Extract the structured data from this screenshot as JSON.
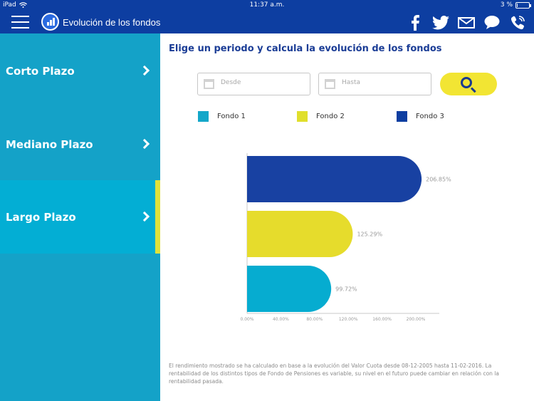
{
  "status_bar": {
    "device": "iPad",
    "time": "11:37 a.m.",
    "battery": "3 %"
  },
  "nav": {
    "title": "Evolución de los fondos",
    "actions": [
      {
        "icon": "facebook-icon"
      },
      {
        "icon": "twitter-icon"
      },
      {
        "icon": "mail-icon"
      },
      {
        "icon": "chat-icon"
      },
      {
        "icon": "phone-icon"
      }
    ]
  },
  "sidebar": {
    "items": [
      {
        "label": "Corto Plazo",
        "active": false
      },
      {
        "label": "Mediano Plazo",
        "active": false
      },
      {
        "label": "Largo Plazo",
        "active": true
      }
    ]
  },
  "main": {
    "heading": "Elige un periodo y calcula la evolución de los fondos",
    "from_placeholder": "Desde",
    "to_placeholder": "Hasta",
    "legend": [
      {
        "label": "Fondo 1",
        "color": "#14a7c9"
      },
      {
        "label": "Fondo 2",
        "color": "#e0df2c"
      },
      {
        "label": "Fondo 3",
        "color": "#0d3ea1"
      }
    ],
    "footnote": "El rendimiento mostrado se ha calculado en base a la evolución del Valor Cuota desde 08-12-2005 hasta 11-02-2016. La rentabilidad de los distintos tipos de Fondo de Pensiones es variable, su nivel en el futuro puede cambiar en relación con la rentabilidad pasada."
  },
  "chart_data": {
    "type": "bar",
    "orientation": "horizontal",
    "categories": [
      "Fondo 3",
      "Fondo 2",
      "Fondo 1"
    ],
    "values": [
      206.85,
      125.29,
      99.72
    ],
    "value_labels": [
      "206.85%",
      "125.29%",
      "99.72%"
    ],
    "colors": [
      "#1841a2",
      "#e6dc2c",
      "#06acd0"
    ],
    "xlim": [
      0,
      200
    ],
    "xticks": [
      "0.00%",
      "40.00%",
      "80.00%",
      "120.00%",
      "160.00%",
      "200.00%"
    ],
    "title": "",
    "xlabel": "",
    "ylabel": ""
  }
}
